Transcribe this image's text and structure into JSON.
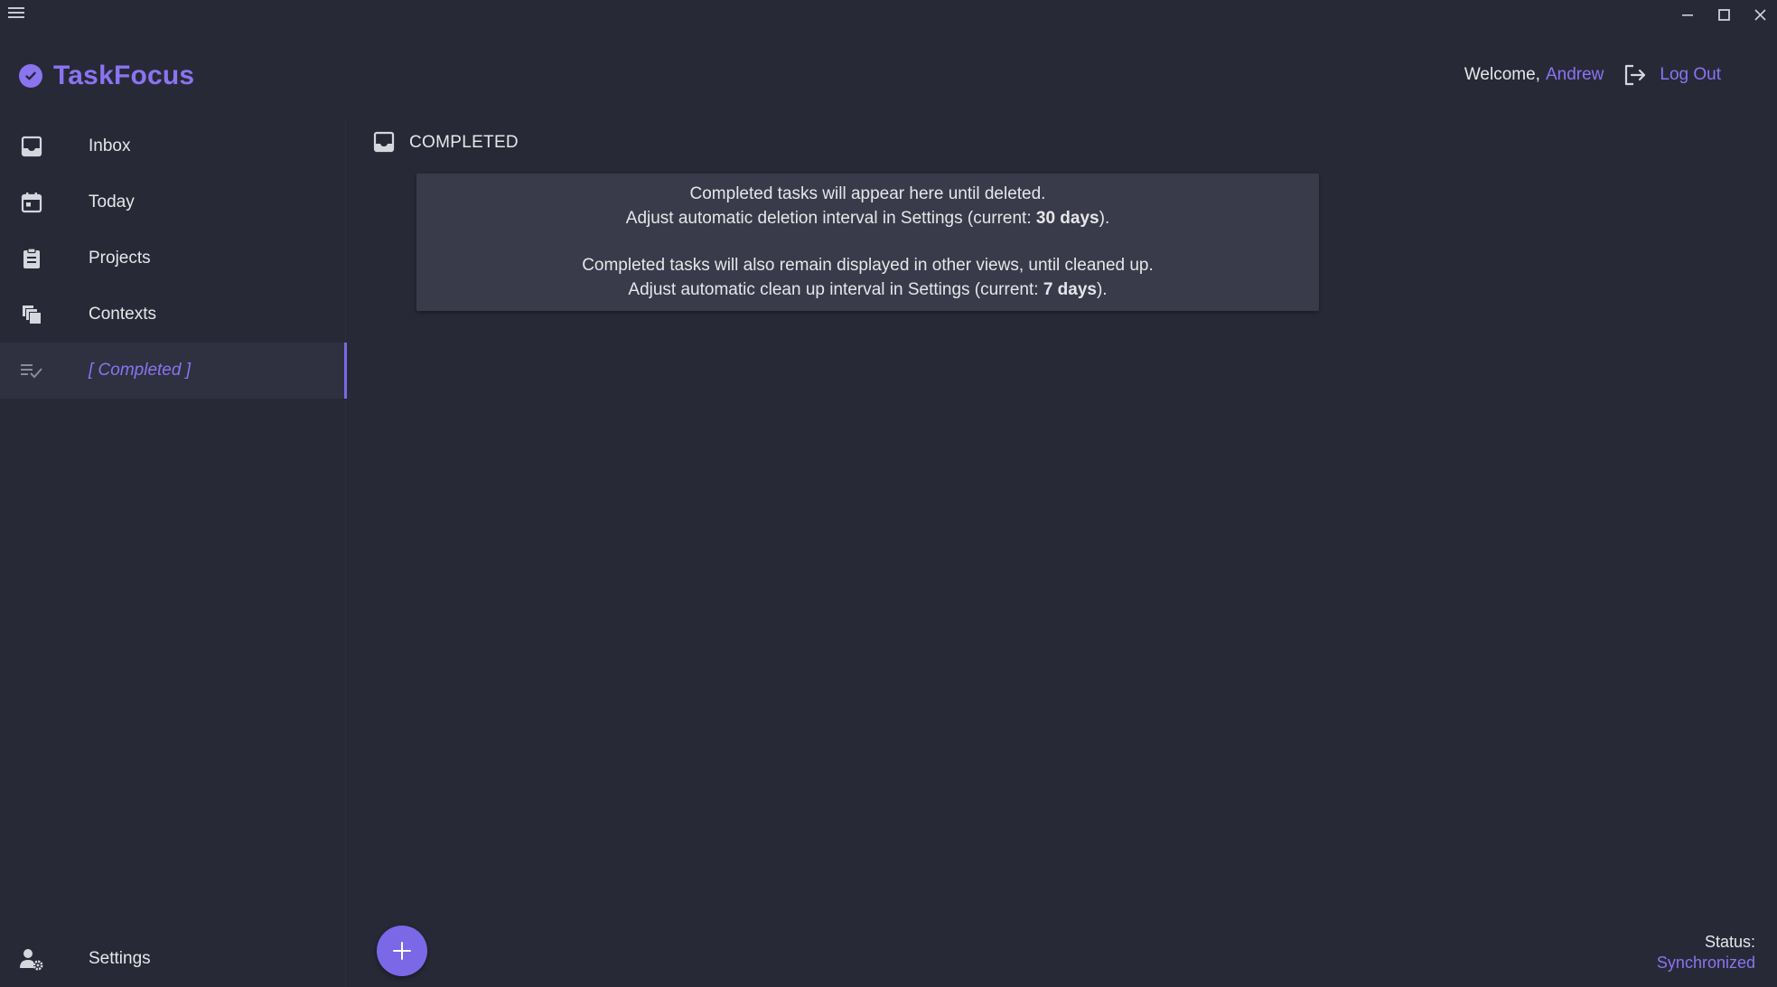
{
  "app": {
    "name": "TaskFocus",
    "accent_color": "#8a74f0",
    "background_color": "#282937"
  },
  "titlebar": {
    "menu_icon": "hamburger-menu-icon",
    "controls": [
      "minimize-icon",
      "maximize-icon",
      "close-icon"
    ]
  },
  "header": {
    "welcome_label": "Welcome,",
    "username": "Andrew",
    "logout_label": "Log Out",
    "logout_icon": "logout-arrow-icon"
  },
  "sidebar": {
    "items": [
      {
        "label": "Inbox",
        "icon": "inbox-tray-icon",
        "active": false
      },
      {
        "label": "Today",
        "icon": "calendar-icon",
        "active": false
      },
      {
        "label": "Projects",
        "icon": "clipboard-icon",
        "active": false
      },
      {
        "label": "Contexts",
        "icon": "stacked-pages-icon",
        "active": false
      },
      {
        "label": "[ Completed ]",
        "icon": "checklist-icon",
        "active": true
      }
    ],
    "settings": {
      "label": "Settings",
      "icon": "user-gear-icon"
    }
  },
  "main": {
    "view_title": "COMPLETED",
    "view_icon": "inbox-tray-icon",
    "info": {
      "line1": "Completed tasks will appear here until deleted.",
      "line2_prefix": "Adjust automatic deletion interval in Settings (current: ",
      "line2_value": "30 days",
      "line2_suffix": ").",
      "line3": "Completed tasks will also remain displayed in other views, until cleaned up.",
      "line4_prefix": "Adjust automatic clean up interval in Settings (current: ",
      "line4_value": "7 days",
      "line4_suffix": ")."
    },
    "fab_icon": "plus-icon"
  },
  "status": {
    "label": "Status:",
    "value": "Synchronized"
  }
}
